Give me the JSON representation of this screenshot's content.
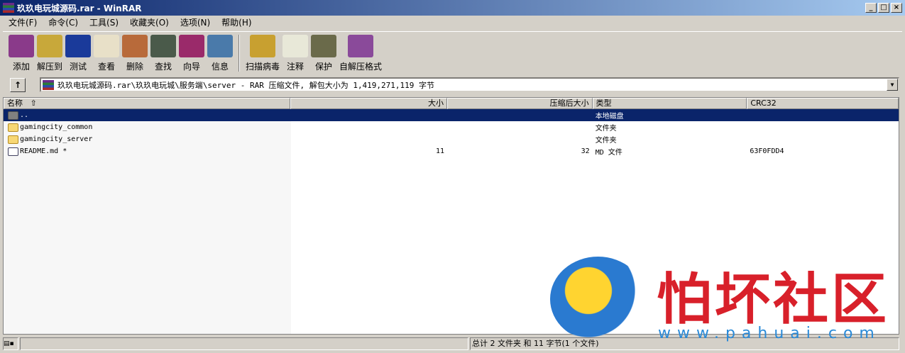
{
  "window": {
    "title": "玖玖电玩城源码.rar - WinRAR",
    "controls": [
      "_",
      "□",
      "×"
    ]
  },
  "menu": [
    "文件(F)",
    "命令(C)",
    "工具(S)",
    "收藏夹(O)",
    "选项(N)",
    "帮助(H)"
  ],
  "toolbar": [
    {
      "label": "添加",
      "icon": "add-archive-icon",
      "color": "#8a3a8a"
    },
    {
      "label": "解压到",
      "icon": "extract-icon",
      "color": "#c8a83a"
    },
    {
      "label": "测试",
      "icon": "test-icon",
      "color": "#1a3a9a"
    },
    {
      "label": "查看",
      "icon": "view-icon",
      "color": "#e8e0c8"
    },
    {
      "label": "删除",
      "icon": "delete-icon",
      "color": "#b86a3a"
    },
    {
      "label": "查找",
      "icon": "find-icon",
      "color": "#4a5a4a"
    },
    {
      "label": "向导",
      "icon": "wizard-icon",
      "color": "#9a2a6a"
    },
    {
      "label": "信息",
      "icon": "info-icon",
      "color": "#4a7aaa"
    },
    {
      "label": "扫描病毒",
      "icon": "virus-scan-icon",
      "color": "#c8a030"
    },
    {
      "label": "注释",
      "icon": "comment-icon",
      "color": "#e8e8d8"
    },
    {
      "label": "保护",
      "icon": "protect-icon",
      "color": "#6a6a4a"
    },
    {
      "label": "自解压格式",
      "icon": "sfx-icon",
      "color": "#8a4a9a"
    }
  ],
  "address": {
    "up": "↑",
    "path": "玖玖电玩城源码.rar\\玖玖电玩城\\服务端\\server - RAR 压缩文件, 解包大小为 1,419,271,119 字节"
  },
  "columns": {
    "name": "名称",
    "sort": "⇧",
    "size": "大小",
    "packed": "压缩后大小",
    "type": "类型",
    "crc": "CRC32"
  },
  "rows": [
    {
      "name": "..",
      "size": "",
      "packed": "",
      "type": "本地磁盘",
      "crc": "",
      "icon": "gfolder",
      "selected": true
    },
    {
      "name": "gamingcity_common",
      "size": "",
      "packed": "",
      "type": "文件夹",
      "crc": "",
      "icon": "folder"
    },
    {
      "name": "gamingcity_server",
      "size": "",
      "packed": "",
      "type": "文件夹",
      "crc": "",
      "icon": "folder"
    },
    {
      "name": "README.md *",
      "size": "11",
      "packed": "32",
      "type": "MD 文件",
      "crc": "63F0FDD4",
      "icon": "mdfile"
    }
  ],
  "status": {
    "summary": "总计 2 文件夹 和 11 字节(1 个文件)"
  },
  "watermark": {
    "text": "怕坏社区",
    "url": "www.pahuai.com"
  }
}
